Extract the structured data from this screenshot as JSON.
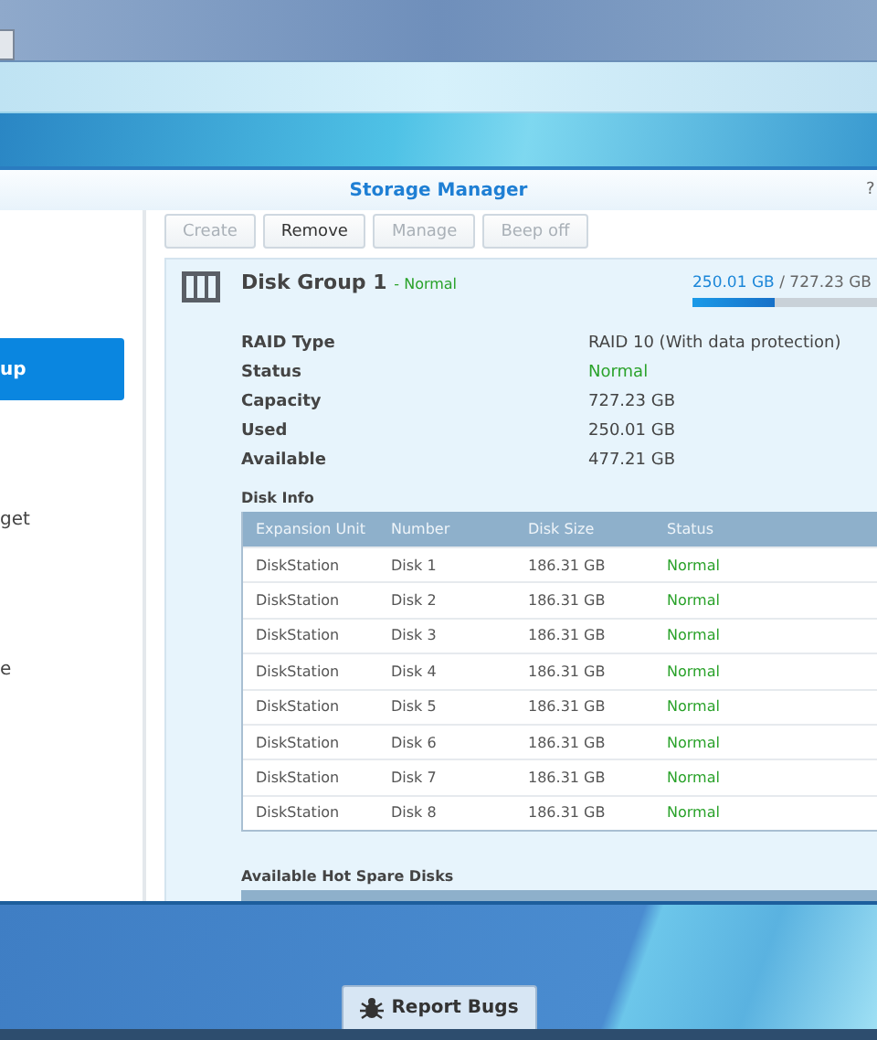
{
  "window": {
    "title": "Storage Manager",
    "help": "?"
  },
  "sidebar": {
    "items": [
      {
        "label": "up",
        "selected": true
      },
      {
        "label": "get",
        "selected": false
      },
      {
        "label": "e",
        "selected": false
      }
    ]
  },
  "toolbar": [
    {
      "label": "Create",
      "disabled": true
    },
    {
      "label": "Remove",
      "disabled": false
    },
    {
      "label": "Manage",
      "disabled": true
    },
    {
      "label": "Beep off",
      "disabled": true
    }
  ],
  "disk_group": {
    "name": "Disk Group 1",
    "separator": "-",
    "status": "Normal",
    "usage": "250.01 GB",
    "total": "727.23 GB",
    "usage_separator": "/",
    "level": 0.344,
    "properties": [
      {
        "label": "RAID Type",
        "value": "RAID 10 (With data protection)",
        "kind": "plain"
      },
      {
        "label": "Status",
        "value": "Normal",
        "kind": "status"
      },
      {
        "label": "Capacity",
        "value": "727.23 GB",
        "kind": "plain"
      },
      {
        "label": "Used",
        "value": "250.01 GB",
        "kind": "plain"
      },
      {
        "label": "Available",
        "value": "477.21 GB",
        "kind": "plain"
      }
    ],
    "disk_info": {
      "title": "Disk Info",
      "columns": [
        "Expansion Unit",
        "Number",
        "Disk Size",
        "Status"
      ],
      "rows": [
        [
          "DiskStation",
          "Disk 1",
          "186.31 GB",
          "Normal"
        ],
        [
          "DiskStation",
          "Disk 2",
          "186.31 GB",
          "Normal"
        ],
        [
          "DiskStation",
          "Disk 3",
          "186.31 GB",
          "Normal"
        ],
        [
          "DiskStation",
          "Disk 4",
          "186.31 GB",
          "Normal"
        ],
        [
          "DiskStation",
          "Disk 5",
          "186.31 GB",
          "Normal"
        ],
        [
          "DiskStation",
          "Disk 6",
          "186.31 GB",
          "Normal"
        ],
        [
          "DiskStation",
          "Disk 7",
          "186.31 GB",
          "Normal"
        ],
        [
          "DiskStation",
          "Disk 8",
          "186.31 GB",
          "Normal"
        ]
      ]
    },
    "hot_spare": {
      "title": "Available Hot Spare Disks"
    }
  },
  "taskbar": {
    "button": "Report Bugs"
  }
}
